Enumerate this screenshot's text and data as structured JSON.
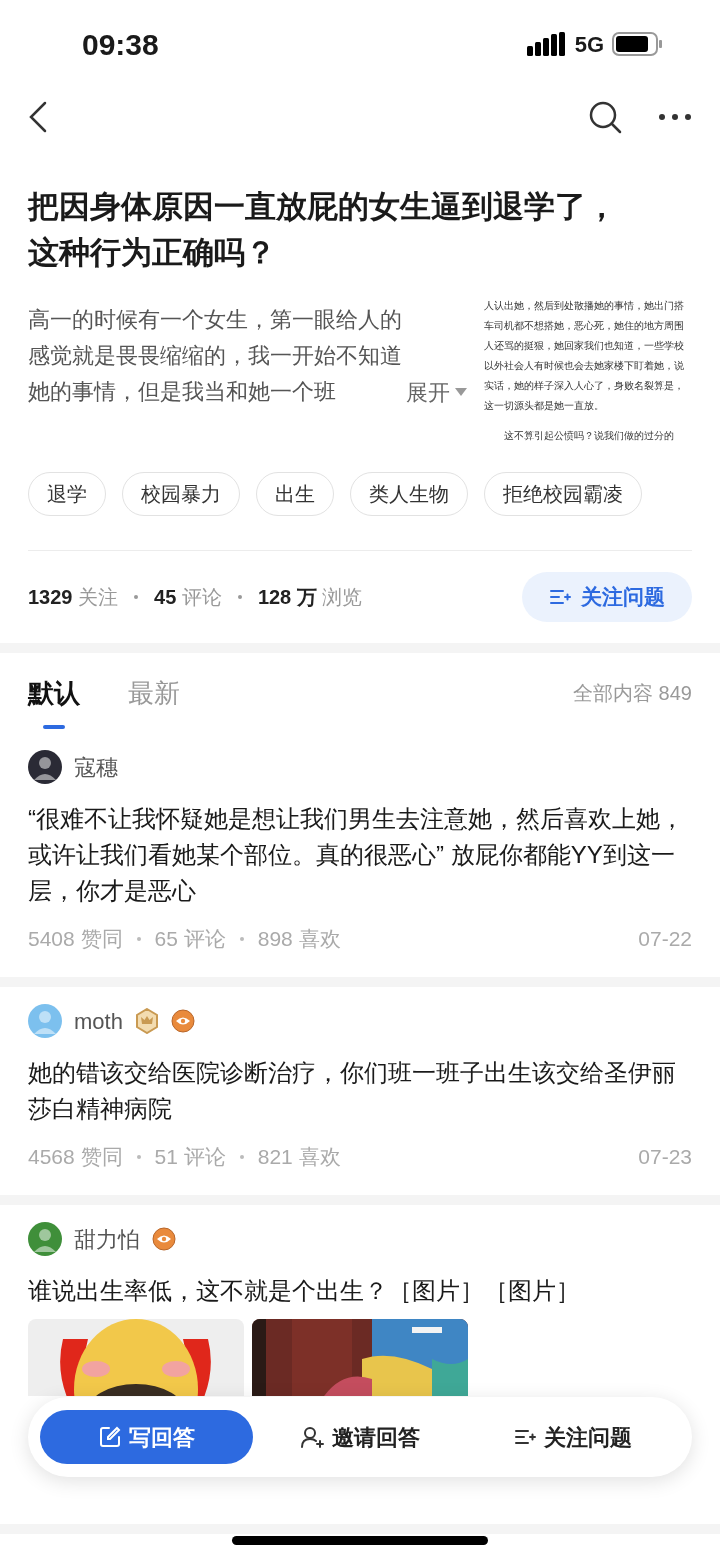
{
  "status_bar": {
    "time": "09:38",
    "network": "5G"
  },
  "question": {
    "title": "把因身体原因一直放屁的女生逼到退学了，这种行为正确吗？",
    "description": "高一的时候有一个女生，第一眼给人的感觉就是畏畏缩缩的，我一开始不知道她的事情，但是我当和她一个班",
    "expand": "展开",
    "thumbnail_paragraphs": [
      "人认出她，然后到处散播她的事情，她出门搭车司机都不想搭她，恶心死，她住的地方周围人还骂的挺狠，她回家我们也知道，一些学校以外社会人有时候也会去她家楼下盯着她，说实话，她的样子深入人心了，身败名裂算是，这一切源头都是她一直放。",
      "这不算引起公愤吗？说我们做的过分的"
    ],
    "tags": [
      "退学",
      "校园暴力",
      "出生",
      "类人生物",
      "拒绝校园霸凌"
    ],
    "stats": [
      "**1329** 关注",
      "**45** 评论",
      "**128 万** 浏览"
    ],
    "follow_button": "关注问题"
  },
  "tabs": [
    {
      "label": "默认",
      "selected": true
    },
    {
      "label": "最新",
      "selected": false
    }
  ],
  "total": "全部内容 849",
  "answers": [
    {
      "author": "寇穗",
      "color": "#2a2a35",
      "text": "“很难不让我怀疑她是想让我们男生去注意她，然后喜欢上她，或许让我们看她某个部位。真的很恶心” 放屁你都能YY到这一层，你才是恶心",
      "stats": [
        "5408 赞同",
        "65 评论",
        "898 喜欢"
      ],
      "date": "07-22"
    },
    {
      "author": "moth",
      "color": "#7cc0ee",
      "badges": [
        {
          "kind": "crown"
        },
        {
          "kind": "eye"
        }
      ],
      "text": "她的错该交给医院诊断治疗，你们班一班子出生该交给圣伊丽莎白精神病院",
      "stats": [
        "4568 赞同",
        "51 评论",
        "821 喜欢"
      ],
      "date": "07-23"
    },
    {
      "author": "甜力怕",
      "color": "#3f8f3a",
      "badges": [
        {
          "kind": "eye"
        }
      ],
      "text": "谁说出生率低，这不就是个出生？［图片］［图片］",
      "images": [
        {
          "kind": "picture"
        },
        {
          "kind": "picture"
        }
      ]
    }
  ],
  "bottom_bar": [
    {
      "label": "写回答",
      "kind": "write",
      "primary": true
    },
    {
      "label": "邀请回答",
      "kind": "invite",
      "primary": false
    },
    {
      "label": "关注问题",
      "kind": "follow",
      "primary": false
    }
  ]
}
